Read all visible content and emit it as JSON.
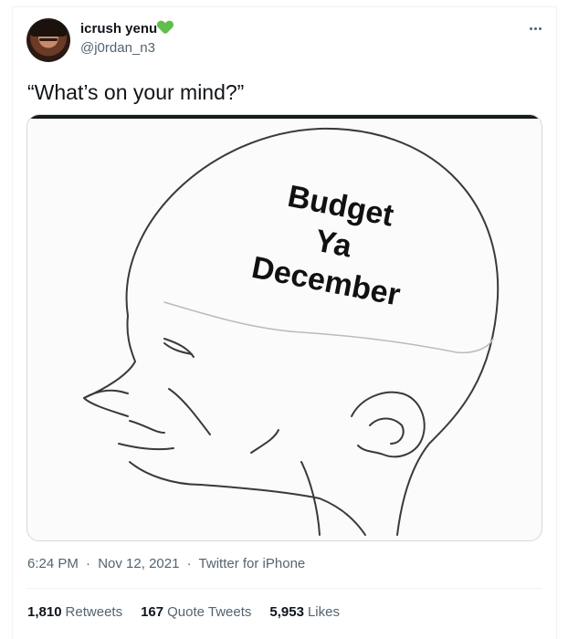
{
  "tweet": {
    "display_name": "icrush yenu",
    "name_emoji": "green-heart",
    "handle": "@j0rdan_n3",
    "text": "“What’s on your mind?”",
    "media": {
      "caption_lines": [
        "Budget",
        "Ya",
        "December"
      ]
    },
    "time": "6:24 PM",
    "date": "Nov 12, 2021",
    "separator": "·",
    "source": "Twitter for iPhone",
    "stats": [
      {
        "count": "1,810",
        "label": "Retweets"
      },
      {
        "count": "167",
        "label": "Quote Tweets"
      },
      {
        "count": "5,953",
        "label": "Likes"
      }
    ]
  },
  "colors": {
    "primary_text": "#0f1419",
    "secondary_text": "#536471",
    "border": "#cfd9de",
    "heart": "#5fbf4a"
  }
}
